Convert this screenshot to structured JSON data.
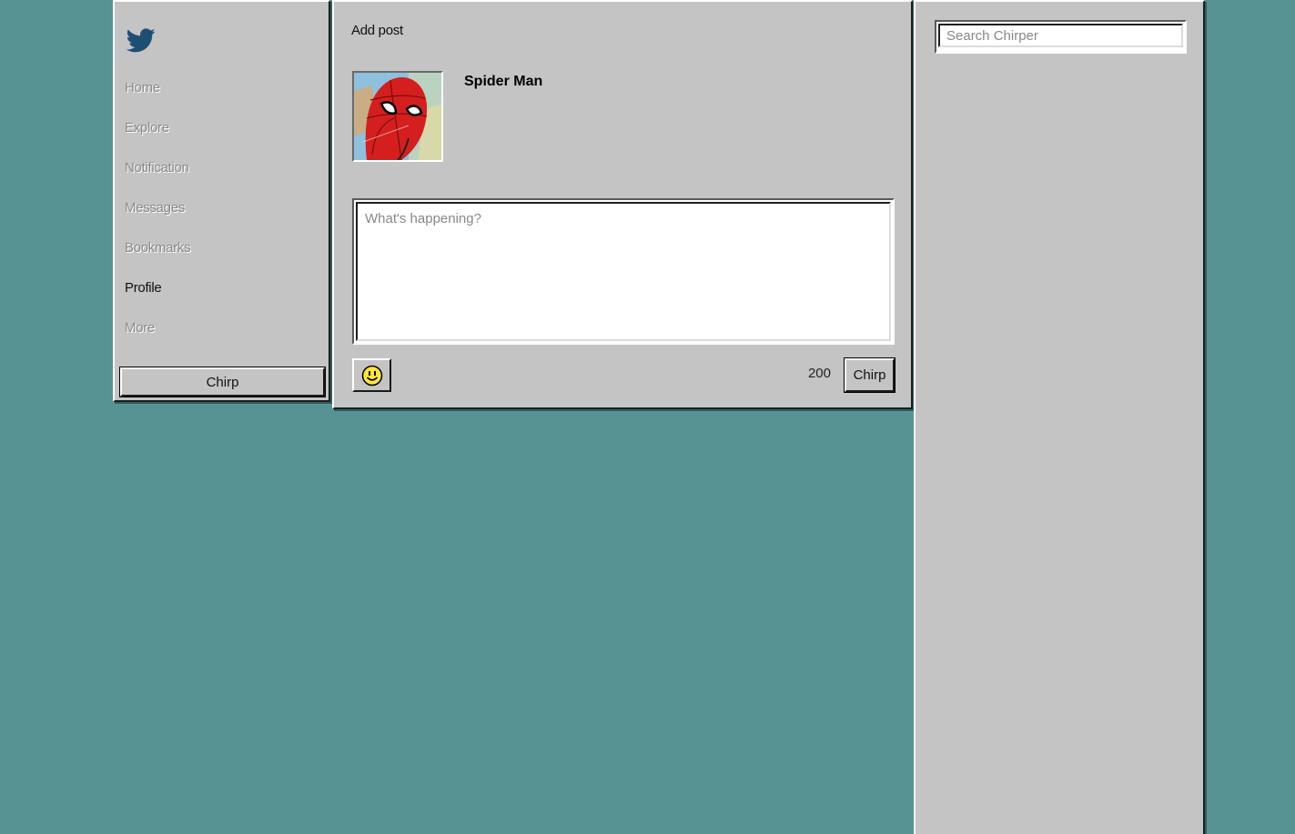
{
  "app": {
    "logo_icon": "bird-icon",
    "logo_color": "#1d4f73"
  },
  "sidebar": {
    "items": [
      {
        "label": "Home",
        "active": false
      },
      {
        "label": "Explore",
        "active": false
      },
      {
        "label": "Notification",
        "active": false
      },
      {
        "label": "Messages",
        "active": false
      },
      {
        "label": "Bookmarks",
        "active": false
      },
      {
        "label": "Profile",
        "active": true
      },
      {
        "label": "More",
        "active": false
      }
    ],
    "chirp_label": "Chirp"
  },
  "composer": {
    "title": "Add post",
    "user": {
      "name": "Spider Man",
      "avatar_icon": "spider-man-avatar"
    },
    "placeholder": "What's happening?",
    "value": "",
    "emoji_icon": "smiley-icon",
    "char_count": "200",
    "chirp_label": "Chirp"
  },
  "search": {
    "placeholder": "Search Chirper",
    "value": ""
  },
  "colors": {
    "desktop": "#579393",
    "window": "#c4c4c4",
    "inactive_text": "#8a8a8a"
  }
}
